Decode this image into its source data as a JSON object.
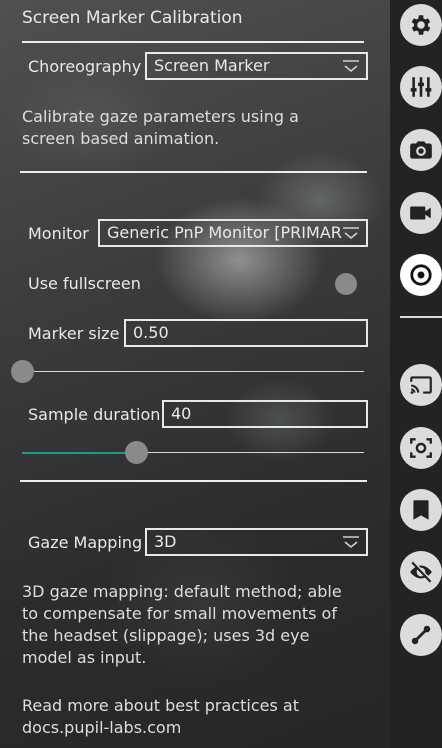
{
  "panel": {
    "title": "Screen Marker Calibration",
    "choreography": {
      "label": "Choreography",
      "value": "Screen Marker"
    },
    "calib_desc": "Calibrate gaze parameters using a screen based animation.",
    "monitor": {
      "label": "Monitor",
      "value": "Generic PnP Monitor [PRIMAR"
    },
    "fullscreen": {
      "label": "Use fullscreen",
      "value": false
    },
    "marker_size": {
      "label": "Marker size",
      "value": "0.50",
      "fraction": 0.0
    },
    "sample_duration": {
      "label": "Sample duration",
      "value": "40",
      "fraction": 0.33
    },
    "gaze_mapping": {
      "label": "Gaze Mapping",
      "value": "3D"
    },
    "mapping_desc": "3D gaze mapping: default method; able to compensate for small movements of the headset (slippage); uses 3d eye model as input.",
    "more_info": "Read more about best practices at docs.pupil-labs.com"
  },
  "sidebar": {
    "buttons": [
      {
        "icon": "gear-icon"
      },
      {
        "icon": "sliders-icon"
      },
      {
        "icon": "camera-icon"
      },
      {
        "icon": "video-camera-icon"
      },
      {
        "icon": "calibration-target-icon",
        "active": true
      },
      {
        "icon": "cast-icon"
      },
      {
        "icon": "focus-scan-icon"
      },
      {
        "icon": "bookmark-icon"
      },
      {
        "icon": "eye-off-icon"
      },
      {
        "icon": "pen-tool-icon"
      }
    ]
  },
  "colors": {
    "accent": "#1a9b8c",
    "sidebar_bg": "#232323"
  }
}
